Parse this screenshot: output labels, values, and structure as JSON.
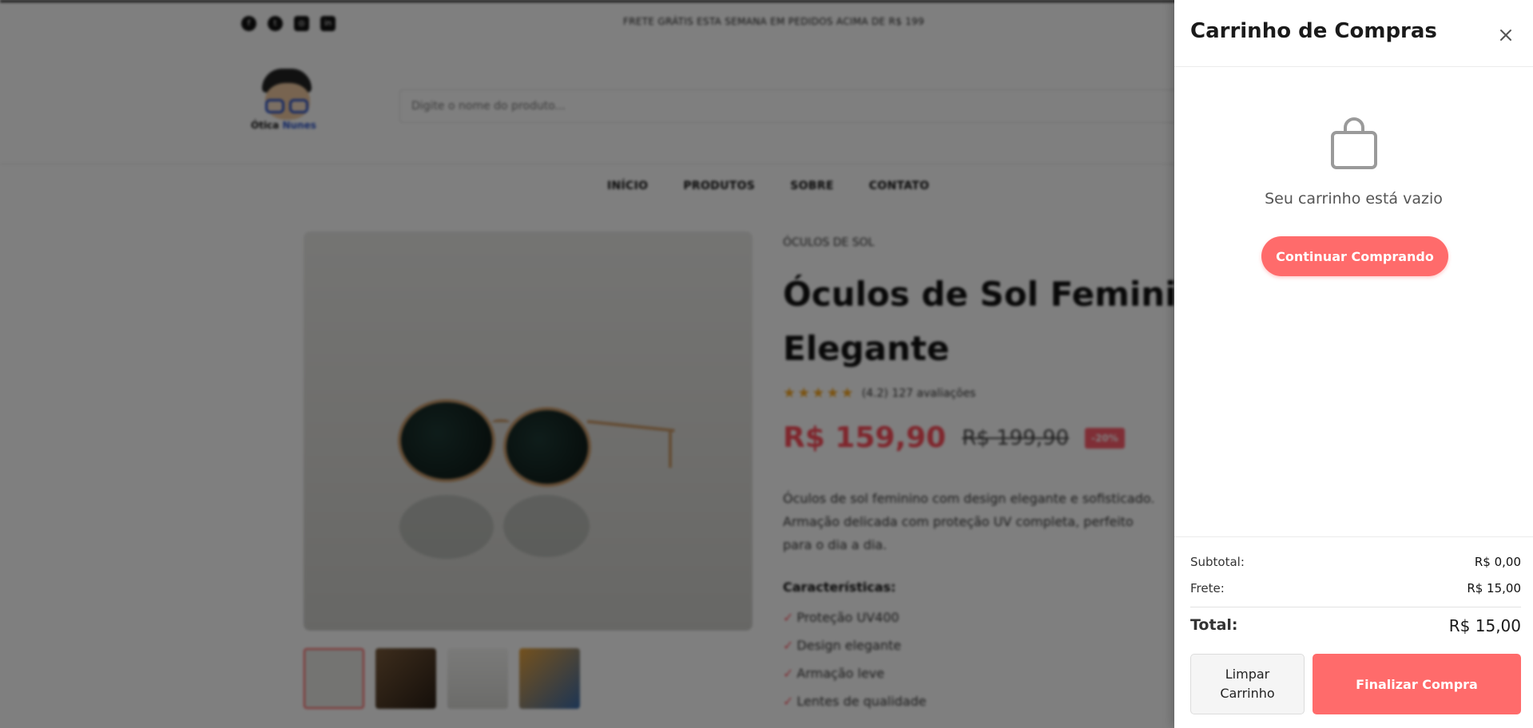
{
  "header": {
    "promo": "FRETE GRÁTIS ESTA SEMANA EM PEDIDOS ACIMA DE R$ 199",
    "social": [
      "facebook-icon",
      "twitter-icon",
      "instagram-icon",
      "linkedin-icon"
    ],
    "logo": {
      "name_part1": "Ótica",
      "name_part2": "Nunes"
    },
    "search_placeholder": "Digite o nome do produto..."
  },
  "nav": {
    "items": [
      "INÍCIO",
      "PRODUTOS",
      "SOBRE",
      "CONTATO"
    ]
  },
  "product": {
    "category": "ÓCULOS DE SOL",
    "title": "Óculos de Sol Feminino Elegante",
    "rating_stars": "★★★★★",
    "rating_value": 4.2,
    "rating_text": "(4.2) 127 avaliações",
    "price_current": "R$ 159,90",
    "price_old": "R$ 199,90",
    "discount": "-20%",
    "description": "Óculos de sol feminino com design elegante e sofisticado. Armação delicada com proteção UV completa, perfeito para o dia a dia.",
    "features_title": "Características:",
    "features": [
      "Proteção UV400",
      "Design elegante",
      "Armação leve",
      "Lentes de qualidade"
    ],
    "check_mark": "✓"
  },
  "cart": {
    "title": "Carrinho de Compras",
    "close_icon": "close-icon",
    "empty_icon": "shopping-bag-icon",
    "empty_message": "Seu carrinho está vazio",
    "continue_label": "Continuar Comprando",
    "subtotal_label": "Subtotal:",
    "subtotal_value": "R$ 0,00",
    "shipping_label": "Frete:",
    "shipping_value": "R$ 15,00",
    "total_label": "Total:",
    "total_value": "R$ 15,00",
    "clear_label_line1": "Limpar",
    "clear_label_line2": "Carrinho",
    "checkout_label": "Finalizar Compra"
  },
  "colors": {
    "accent": "#ff6b6b",
    "price": "#ff4d5a",
    "overlay": "rgba(0,0,0,0.5)"
  }
}
